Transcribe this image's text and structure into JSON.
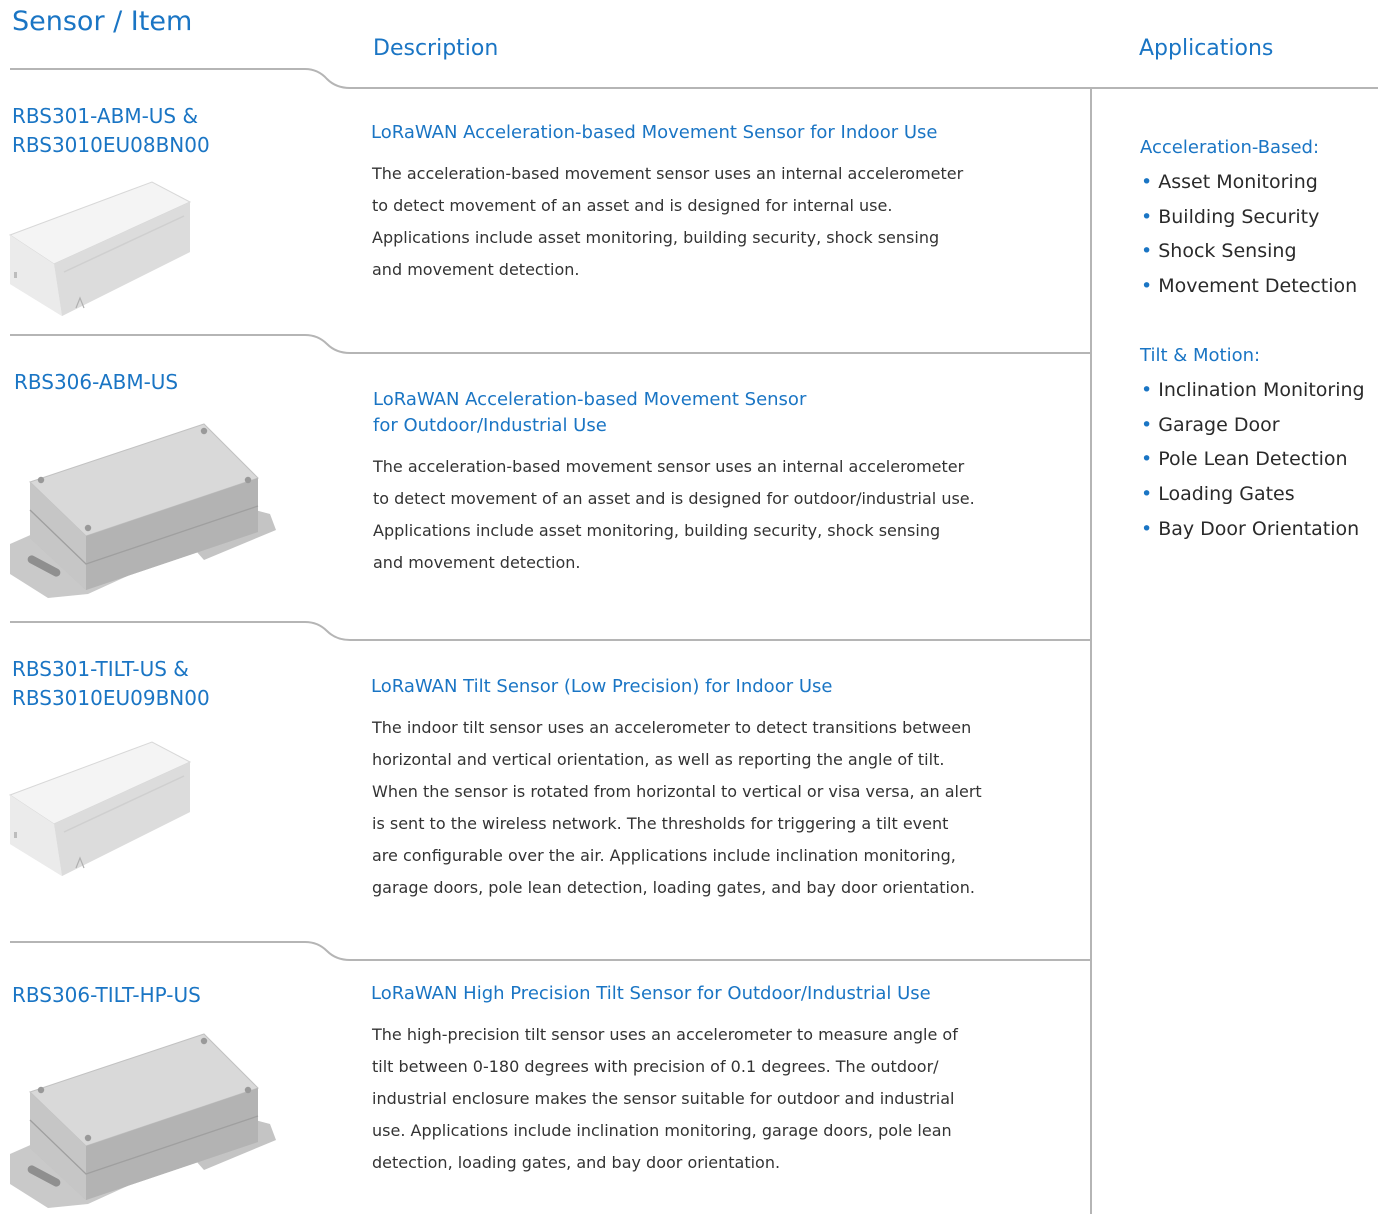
{
  "headers": {
    "sensor": "Sensor / Item",
    "description": "Description",
    "applications": "Applications"
  },
  "colors": {
    "accent": "#1a75c4",
    "divider": "#b5b5b5",
    "text": "#333333"
  },
  "sensors": [
    {
      "name_lines": [
        "RBS301-ABM-US &",
        "RBS3010EU08BN00"
      ],
      "image": "indoor-enclosure",
      "title_lines": [
        "LoRaWAN Acceleration-based Movement Sensor for Indoor Use"
      ],
      "description_lines": [
        "The acceleration-based movement sensor uses an internal accelerometer",
        "to detect movement of an asset and is designed for internal use.",
        "Applications include asset monitoring, building security, shock sensing",
        "and movement detection."
      ]
    },
    {
      "name_lines": [
        "RBS306-ABM-US"
      ],
      "image": "outdoor-enclosure",
      "title_lines": [
        "LoRaWAN Acceleration-based Movement Sensor",
        "for Outdoor/Industrial Use"
      ],
      "description_lines": [
        "The acceleration-based movement sensor uses an internal accelerometer",
        "to detect movement of an asset and is designed for outdoor/industrial use.",
        "Applications include asset monitoring, building security, shock sensing",
        "and movement detection."
      ]
    },
    {
      "name_lines": [
        "RBS301-TILT-US &",
        "RBS3010EU09BN00"
      ],
      "image": "indoor-enclosure",
      "title_lines": [
        "LoRaWAN Tilt Sensor (Low Precision) for Indoor Use"
      ],
      "description_lines": [
        "The indoor tilt sensor uses an accelerometer to detect transitions between",
        "horizontal and vertical orientation, as well as reporting the angle of tilt.",
        "When the sensor is rotated from horizontal to vertical or visa versa, an alert",
        "is sent to the wireless network. The thresholds for triggering a tilt event",
        "are configurable over the air. Applications include inclination monitoring,",
        "garage doors, pole lean detection, loading gates, and bay door orientation."
      ]
    },
    {
      "name_lines": [
        "RBS306-TILT-HP-US"
      ],
      "image": "outdoor-enclosure",
      "title_lines": [
        "LoRaWAN High Precision Tilt Sensor for Outdoor/Industrial Use"
      ],
      "description_lines": [
        "The high-precision tilt sensor uses an accelerometer to measure angle of",
        "tilt between 0-180 degrees with precision of 0.1 degrees. The outdoor/",
        "industrial enclosure makes the sensor suitable for outdoor and industrial",
        "use. Applications include inclination monitoring, garage doors, pole lean",
        "detection, loading gates, and bay door orientation."
      ]
    }
  ],
  "applications": [
    {
      "title": "Acceleration-Based:",
      "bullet": "•",
      "items": [
        "Asset Monitoring",
        "Building Security",
        "Shock Sensing",
        "Movement Detection"
      ]
    },
    {
      "title": "Tilt & Motion:",
      "bullet": "•",
      "items": [
        "Inclination Monitoring",
        "Garage Door",
        "Pole Lean Detection",
        "Loading Gates",
        "Bay Door Orientation"
      ]
    }
  ]
}
